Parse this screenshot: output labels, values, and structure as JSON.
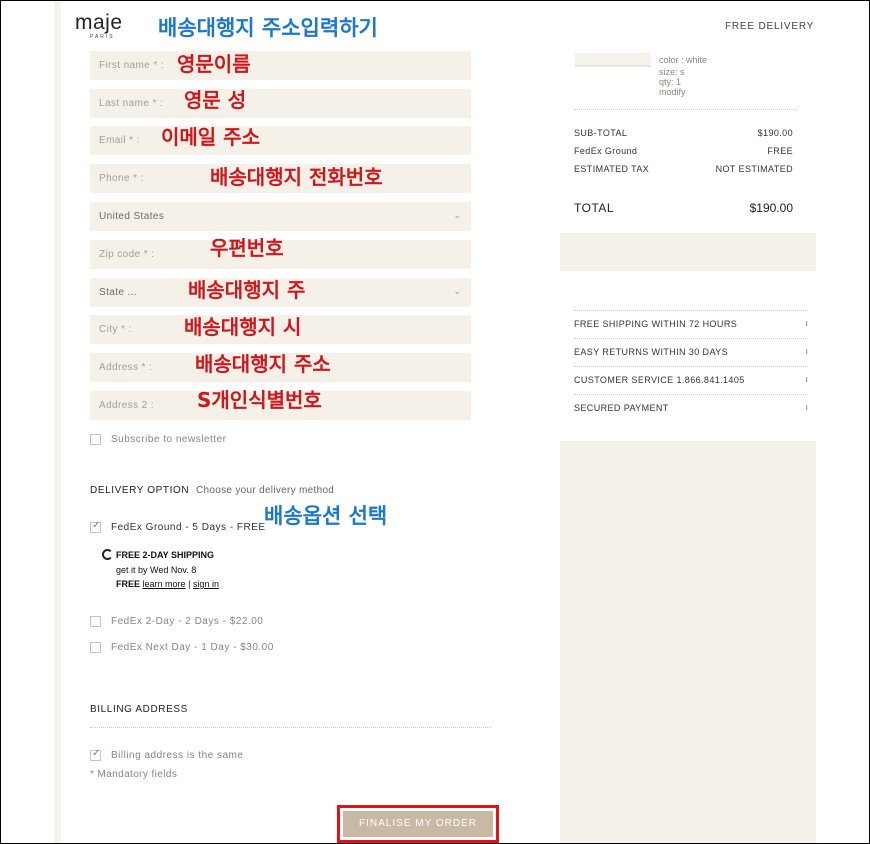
{
  "header": {
    "logo": "maje",
    "logo_sub": "PARIS",
    "right_text": "FREE DELIVERY",
    "annotation": "배송대행지 주소입력하기"
  },
  "form": {
    "first_name": {
      "placeholder": "First name * :",
      "annotation": "영문이름"
    },
    "last_name": {
      "placeholder": "Last name * :",
      "annotation": "영문 성"
    },
    "email": {
      "placeholder": "Email * :",
      "annotation": "이메일 주소"
    },
    "phone": {
      "placeholder": "Phone * :",
      "annotation": "배송대행지 전화번호"
    },
    "country": {
      "value": "United States"
    },
    "zip": {
      "placeholder": "Zip code * :",
      "annotation": "우편번호"
    },
    "state": {
      "placeholder": "State ...",
      "annotation": "배송대행지 주"
    },
    "city": {
      "placeholder": "City * :",
      "annotation": "배송대행지 시"
    },
    "address": {
      "placeholder": "Address * :",
      "annotation": "배송대행지 주소"
    },
    "address2": {
      "placeholder": "Address 2 :",
      "annotation": "S개인식별번호"
    },
    "newsletter_label": "Subscribe to newsletter"
  },
  "delivery": {
    "title": "DELIVERY OPTION",
    "subtitle": "Choose your delivery method",
    "annotation": "배송옵션 선택",
    "options": [
      {
        "label": "FedEx Ground - 5 Days - FREE",
        "checked": true
      },
      {
        "label": "FedEx 2-Day - 2 Days - $22.00",
        "checked": false
      },
      {
        "label": "FedEx Next Day - 1 Day - $30.00",
        "checked": false
      }
    ],
    "promo": {
      "title": "FREE 2-DAY SHIPPING",
      "line2": "get it by Wed Nov. 8",
      "free": "FREE",
      "learn_more": "learn more",
      "separator": "|",
      "sign_in": "sign in"
    }
  },
  "billing": {
    "title": "BILLING ADDRESS",
    "same_label": "Billing address is the same",
    "mandatory": "* Mandatory fields"
  },
  "finalise_label": "FINALISE MY ORDER",
  "summary": {
    "product": {
      "color": "color : white",
      "size": "size: s",
      "qty": "qty: 1",
      "modify": "modify"
    },
    "subtotal_label": "SUB-TOTAL",
    "subtotal_value": "$190.00",
    "shipping_label": "FedEx Ground",
    "shipping_value": "FREE",
    "tax_label": "ESTIMATED TAX",
    "tax_value": "NOT ESTIMATED",
    "total_label": "TOTAL",
    "total_value": "$190.00",
    "info": [
      "FREE SHIPPING WITHIN 72 HOURS",
      "EASY RETURNS WITHIN 30 DAYS",
      "CUSTOMER SERVICE 1.866.841.1405",
      "SECURED PAYMENT"
    ]
  }
}
